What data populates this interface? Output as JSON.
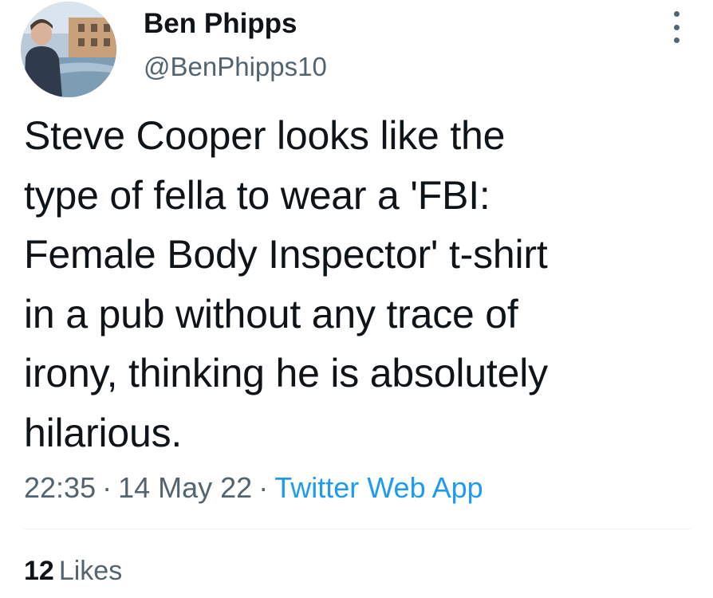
{
  "author": {
    "display_name": "Ben Phipps",
    "handle": "@BenPhipps10",
    "avatar_icon": "profile-photo"
  },
  "tweet": {
    "text": "Steve Cooper looks like the\ntype of fella to wear a 'FBI:\nFemale Body Inspector' t-shirt\nin a pub without any trace of\nirony, thinking he is absolutely\nhilarious."
  },
  "meta": {
    "time": "22:35",
    "separator": "·",
    "date": "14 May 22",
    "source": "Twitter Web App"
  },
  "stats": {
    "likes_count": "12",
    "likes_label": "Likes"
  },
  "icons": {
    "more": "more-vertical-icon"
  },
  "colors": {
    "text": "#0f1419",
    "secondary": "#536471",
    "link": "#1d9bf0",
    "divider": "#eff3f4"
  }
}
